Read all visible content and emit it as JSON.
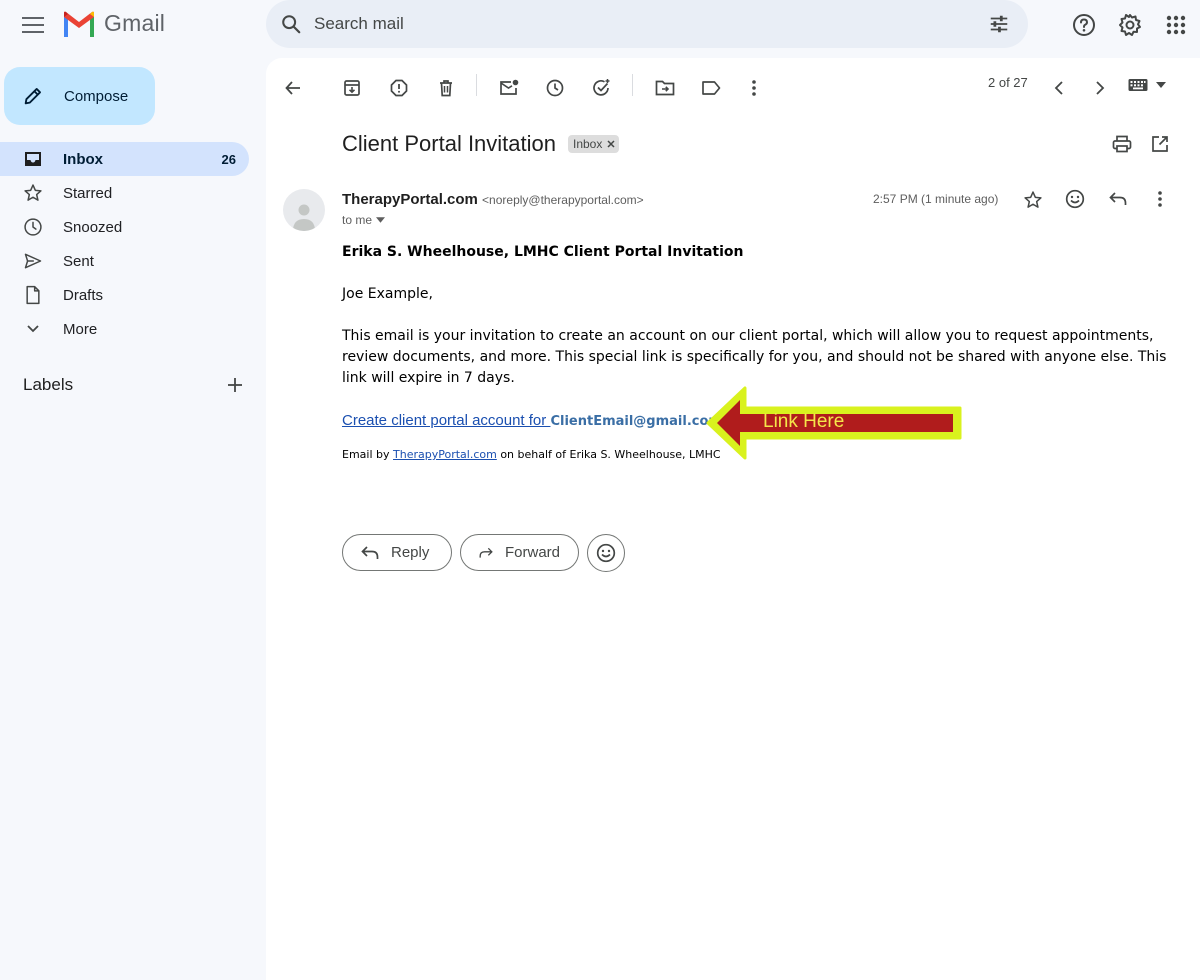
{
  "app": {
    "name": "Gmail"
  },
  "search": {
    "placeholder": "Search mail"
  },
  "sidebar": {
    "compose_label": "Compose",
    "items": [
      {
        "label": "Inbox",
        "count": "26",
        "icon": "inbox-icon"
      },
      {
        "label": "Starred",
        "count": "",
        "icon": "star-icon"
      },
      {
        "label": "Snoozed",
        "count": "",
        "icon": "clock-icon"
      },
      {
        "label": "Sent",
        "count": "",
        "icon": "send-icon"
      },
      {
        "label": "Drafts",
        "count": "",
        "icon": "draft-icon"
      },
      {
        "label": "More",
        "count": "",
        "icon": "chevron-down-icon"
      }
    ],
    "labels_title": "Labels"
  },
  "toolbar": {
    "pager": "2 of 27"
  },
  "email": {
    "subject": "Client Portal Invitation",
    "label_chip": "Inbox",
    "sender_name": "TherapyPortal.com",
    "sender_email": "<noreply@therapyportal.com>",
    "to": "to me",
    "time": "2:57 PM (1 minute ago)",
    "heading": "Erika S. Wheelhouse, LMHC Client Portal Invitation",
    "greeting": "Joe Example,",
    "paragraph": "This email is your invitation to create an account on our client portal, which will allow you to request appointments, review documents, and more. This special link is specifically for you, and should not be shared with anyone else. This link will expire in 7 days.",
    "link_text": "Create client portal account for ",
    "link_email": "ClientEmail@gmail.com",
    "footer_prefix": "Email by ",
    "footer_link": "TherapyPortal.com",
    "footer_suffix": " on behalf of Erika S. Wheelhouse, LMHC"
  },
  "annotation": {
    "label": "Link Here",
    "arrow_color": "#b01c1c",
    "outline_color": "#d9f21e"
  },
  "actions": {
    "reply_label": "Reply",
    "forward_label": "Forward"
  },
  "colors": {
    "accent": "#c2e7ff",
    "active_nav": "#d3e3fd",
    "background": "#f6f8fc"
  }
}
